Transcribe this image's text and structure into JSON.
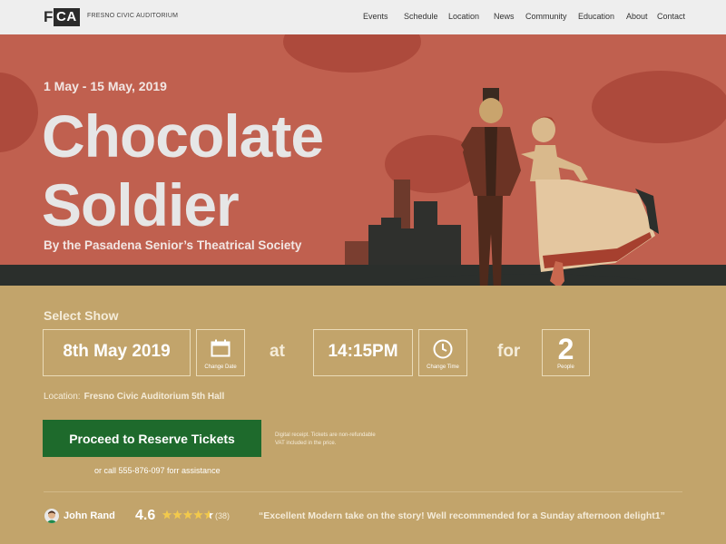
{
  "header": {
    "logo_f": "F",
    "logo_ca": "CA",
    "org_name": "FRESNO CIVIC AUDITORIUM",
    "nav": [
      {
        "label": "Events"
      },
      {
        "label": "Schedule"
      },
      {
        "label": "Location"
      },
      {
        "label": "News"
      },
      {
        "label": "Community"
      },
      {
        "label": "Education"
      },
      {
        "label": "About"
      },
      {
        "label": "Contact"
      }
    ]
  },
  "hero": {
    "date_range": "1 May - 15 May, 2019",
    "title_line1": "Chocolate",
    "title_line2": "Soldier",
    "subtitle": "By the Pasadena Senior’s Theatrical Society"
  },
  "booking": {
    "heading": "Select Show",
    "date_value": "8th May 2019",
    "change_date_label": "Change Date",
    "at_label": "at",
    "time_value": "14:15PM",
    "change_time_label": "Change Time",
    "for_label": "for",
    "people_count": "2",
    "people_label": "People",
    "location_label": "Location:",
    "location_value": "Fresno Civic Auditorium 5th Hall",
    "cta_label": "Proceed to Reserve Tickets",
    "cta_note": "or call 555-876-097 forr assistance",
    "fineprint_line1": "Digital receipt. Tickets are non-refundable",
    "fineprint_line2": "VAT included in the price."
  },
  "review": {
    "reviewer": "John Rand",
    "rating": "4.6",
    "rating_value": 4.6,
    "review_count": "(38)",
    "quote": "“Excellent Modern take on the story! Well recommended for a Sunday afternoon delight1”"
  },
  "colors": {
    "hero_bg": "#c0604f",
    "page_bg": "#c2a46b",
    "cta": "#1e6a2c",
    "dark": "#2b2f2c",
    "stars": "#f2c94c"
  }
}
